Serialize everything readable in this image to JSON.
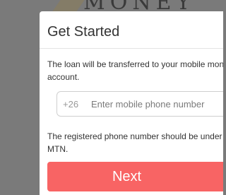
{
  "background": {
    "brand_text": "MONEY"
  },
  "modal": {
    "title": "Get Started",
    "info_transfer": "The loan will be transferred to your mobile money account.",
    "phone": {
      "prefix": "+26",
      "placeholder": "Enter mobile phone number",
      "value": ""
    },
    "info_registered": "The registered phone number should be under Airtel or MTN.",
    "next_label": "Next"
  },
  "colors": {
    "overlay": "#7a7a7a",
    "accent": "#f86464",
    "text": "#333333"
  }
}
